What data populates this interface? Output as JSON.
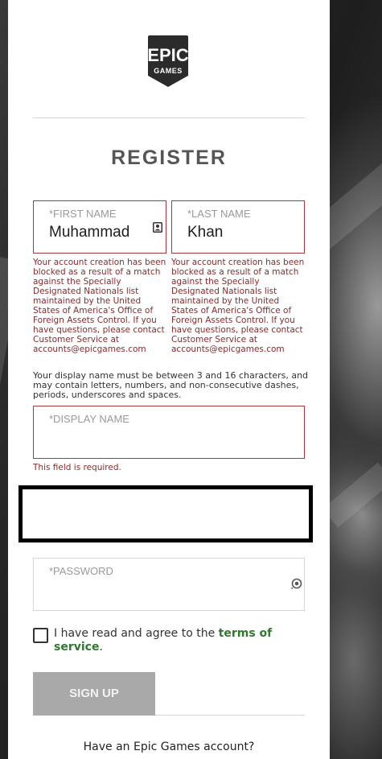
{
  "logo": {
    "line1": "EPIC",
    "line2": "GAMES"
  },
  "form": {
    "title": "REGISTER",
    "first_name": {
      "label": "*FIRST NAME",
      "value": "Muhammad",
      "error": "Your account creation has been blocked as a result of a match against the Specially Designated Nationals list maintained by the United States of America's Office of Foreign Assets Control. If you have questions, please contact Customer Service at accounts@epicgames.com"
    },
    "last_name": {
      "label": "*LAST NAME",
      "value": "Khan",
      "error": "Your account creation has been blocked as a result of a match against the Specially Designated Nationals list maintained by the United States of America's Office of Foreign Assets Control. If you have questions, please contact Customer Service at accounts@epicgames.com"
    },
    "display_name_hint": "Your display name must be between 3 and 16 characters, and may contain letters, numbers, and non-consecutive dashes, periods, underscores and spaces.",
    "display_name": {
      "label": "*DISPLAY NAME",
      "value": "",
      "error": "This field is required."
    },
    "password": {
      "label": "*PASSWORD",
      "value": ""
    },
    "agree": {
      "prefix": "I have read and agree to the ",
      "link": "terms of service",
      "suffix": "."
    },
    "signup_label": "SIGN UP",
    "have_account": "Have an Epic Games account?"
  },
  "icons": {
    "first_name": "contact-card-icon",
    "password": "show-password-icon"
  },
  "colors": {
    "error": "#a63a3a",
    "error_text": "#8a2b2b",
    "link": "#2f7a2f",
    "signup_bg": "#a9a9a9"
  }
}
